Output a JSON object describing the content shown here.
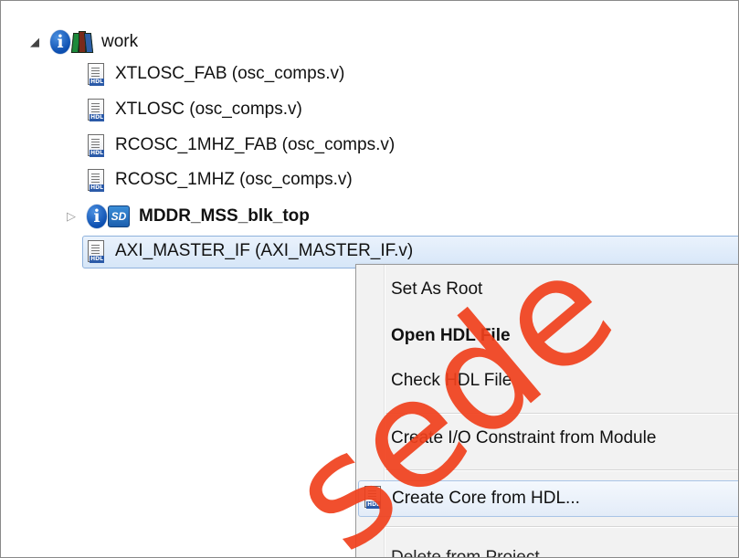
{
  "tree": {
    "root": {
      "label": "work"
    },
    "items": [
      {
        "label": "XTLOSC_FAB (osc_comps.v)"
      },
      {
        "label": "XTLOSC (osc_comps.v)"
      },
      {
        "label": "RCOSC_1MHZ_FAB (osc_comps.v)"
      },
      {
        "label": "RCOSC_1MHZ (osc_comps.v)"
      },
      {
        "label": "MDDR_MSS_blk_top"
      },
      {
        "label": "AXI_MASTER_IF (AXI_MASTER_IF.v)"
      }
    ],
    "hdl_tag": "HDL",
    "sd_badge": "SD"
  },
  "context_menu": {
    "items": [
      {
        "label": "Set As Root"
      },
      {
        "label": "Open HDL File"
      },
      {
        "label": "Check HDL File"
      },
      {
        "label": "Create I/O Constraint from Module"
      },
      {
        "label": "Create Core from HDL..."
      },
      {
        "label": "Delete from Project"
      }
    ]
  },
  "watermark": {
    "text": "sede"
  },
  "colors": {
    "selection": "#d6e6f8",
    "menu_background": "#f2f2f2",
    "watermark": "#f0401c"
  }
}
